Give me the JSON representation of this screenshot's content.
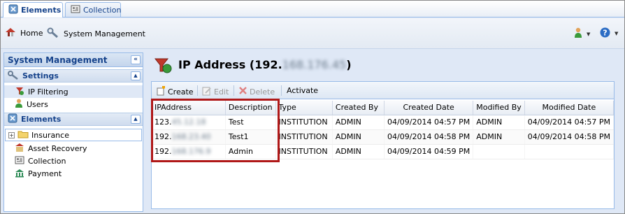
{
  "tabs": [
    {
      "label": "Elements",
      "icon": "elements-icon"
    },
    {
      "label": "Collection",
      "icon": "collection-icon"
    }
  ],
  "toolbar": {
    "home_label": "Home",
    "system_management_label": "System Management"
  },
  "left_panel": {
    "title": "System Management",
    "settings": {
      "title": "Settings",
      "items": [
        {
          "label": "IP Filtering",
          "icon": "ip-filter-icon"
        },
        {
          "label": "Users",
          "icon": "user-icon"
        }
      ]
    },
    "elements": {
      "title": "Elements",
      "items": [
        {
          "label": "Insurance",
          "icon": "folder-icon"
        },
        {
          "label": "Asset Recovery",
          "icon": "asset-recovery-icon"
        },
        {
          "label": "Collection",
          "icon": "collection-icon"
        },
        {
          "label": "Payment",
          "icon": "payment-icon"
        }
      ]
    }
  },
  "main": {
    "title_prefix": "IP Address (192.",
    "title_masked": "168.176.45",
    "title_suffix": ")",
    "grid_toolbar": {
      "create": "Create",
      "edit": "Edit",
      "delete": "Delete",
      "activate": "Activate"
    },
    "columns": [
      "IPAddress",
      "Description",
      "Type",
      "Created By",
      "Created Date",
      "Modified By",
      "Modified Date"
    ],
    "rows": [
      {
        "ip_prefix": "123.",
        "ip_masked": "45.12.18",
        "description": "Test",
        "type": "INSTITUTION",
        "created_by": "ADMIN",
        "created_date": "04/09/2014 04:57 PM",
        "modified_by": "ADMIN",
        "modified_date": "04/09/2014 04:57 PM"
      },
      {
        "ip_prefix": "192.",
        "ip_masked": "168.23.40",
        "description": "Test1",
        "type": "INSTITUTION",
        "created_by": "ADMIN",
        "created_date": "04/09/2014 04:58 PM",
        "modified_by": "ADMIN",
        "modified_date": "04/09/2014 04:58 PM"
      },
      {
        "ip_prefix": "192.",
        "ip_masked": "168.176.9",
        "description": "Admin",
        "type": "INSTITUTION",
        "created_by": "ADMIN",
        "created_date": "04/09/2014 04:59 PM",
        "modified_by": "",
        "modified_date": ""
      }
    ]
  },
  "colors": {
    "header_blue": "#15428b",
    "panel_border": "#99bbe8",
    "highlight_red": "#b01818"
  }
}
